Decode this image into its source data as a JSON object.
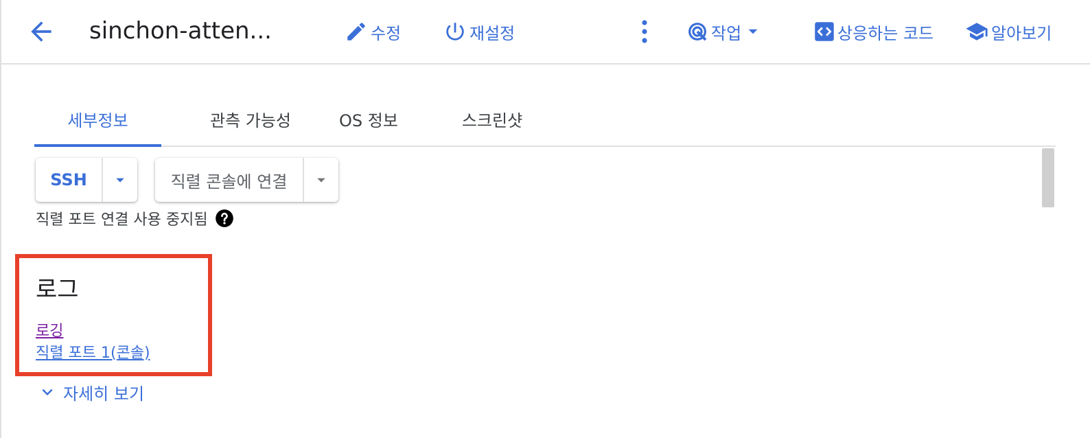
{
  "colors": {
    "accent": "#3b6fd8",
    "visited_link": "#7b1fa2",
    "highlight_box": "#e8402a"
  },
  "header": {
    "title": "sinchon-atten...",
    "buttons": [
      {
        "label": "수정",
        "icon": "pencil-icon"
      },
      {
        "label": "재설정",
        "icon": "power-icon"
      },
      {
        "label": "",
        "icon": "more-vert-icon"
      },
      {
        "label": "작업",
        "icon": "operations-icon",
        "has_dropdown": true
      },
      {
        "label": "상응하는 코드",
        "icon": "code-icon"
      },
      {
        "label": "알아보기",
        "icon": "school-icon"
      }
    ]
  },
  "tabs": [
    {
      "label": "세부정보",
      "active": true
    },
    {
      "label": "관측 가능성",
      "active": false
    },
    {
      "label": "OS 정보",
      "active": false
    },
    {
      "label": "스크린샷",
      "active": false
    }
  ],
  "connect": {
    "ssh_label": "SSH",
    "serial_label": "직렬 콘솔에 연결",
    "disabled_note": "직렬 포트 연결 사용 중지됨"
  },
  "logs": {
    "heading": "로그",
    "links": [
      {
        "label": "로깅",
        "visited": true
      },
      {
        "label": "직렬 포트 1(콘솔)",
        "visited": false
      }
    ],
    "show_more": "자세히 보기"
  }
}
